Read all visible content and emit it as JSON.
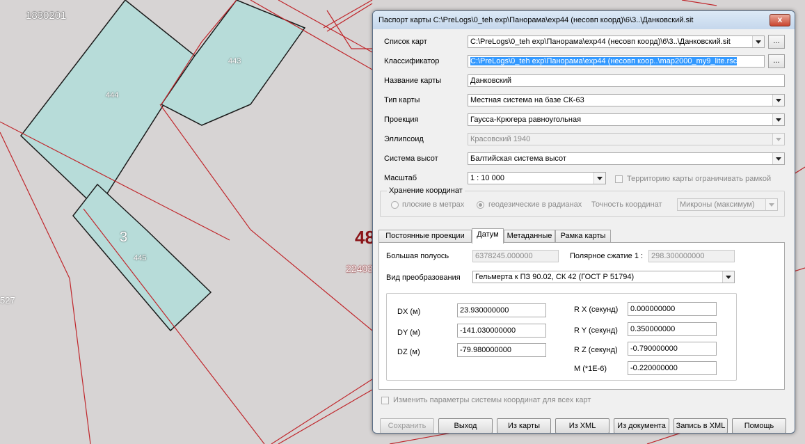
{
  "map": {
    "labels": {
      "code_1830201": "1830201",
      "parcel_444": "444",
      "parcel_443": "443",
      "parcel_445": "445",
      "parcel_3": "3",
      "code_48": "48",
      "code_22403": "22403",
      "code_527": "527"
    },
    "colors": {
      "parcel_fill": "#b7dcd9",
      "boundary": "#c0262b",
      "background": "#d7d4d4"
    }
  },
  "dialog": {
    "title": "Паспорт карты  C:\\PreLogs\\0_teh exp\\Панорама\\exp44 (несовп коорд)\\6\\3..\\Данковский.sit",
    "close_label": "x",
    "map_list": {
      "label": "Список карт",
      "value": "C:\\PreLogs\\0_teh exp\\Панорама\\exp44 (несовп коорд)\\6\\3..\\Данковский.sit",
      "dots": "..."
    },
    "classifier": {
      "label": "Классификатор",
      "value": "C:\\PreLogs\\0_teh exp\\Панорама\\exp44 (несовп коор..\\map2000_my9_lite.rsc",
      "dots": "..."
    },
    "map_name": {
      "label": "Название карты",
      "value": "Данковский"
    },
    "map_type": {
      "label": "Тип карты",
      "value": "Местная система на базе СК-63"
    },
    "projection": {
      "label": "Проекция",
      "value": "Гаусса-Крюгера равноугольная"
    },
    "ellipsoid": {
      "label": "Эллипсоид",
      "value": "Красовский 1940"
    },
    "height_system": {
      "label": "Система высот",
      "value": "Балтийская система высот"
    },
    "scale": {
      "label": "Масштаб",
      "value": "1 : 10 000",
      "limit_checkbox": "Территорию карты ограничивать рамкой"
    },
    "coord_storage": {
      "title": "Хранение координат",
      "flat": "плоские в метрах",
      "geodetic": "геодезические в радианах",
      "accuracy_label": "Точность координат",
      "accuracy_value": "Микроны (максимум)"
    },
    "tabs": [
      "Постоянные проекции",
      "Датум",
      "Метаданные",
      "Рамка карты"
    ],
    "datum": {
      "major_axis_label": "Большая полуось",
      "major_axis_value": "6378245.000000",
      "flattening_label": "Полярное сжатие  1 :",
      "flattening_value": "298.300000000",
      "transform_label": "Вид преобразования",
      "transform_value": "Гельмерта к ПЗ 90.02, СК 42 (ГОСТ Р 51794)",
      "params": {
        "dx_label": "DX (м)",
        "dx": "23.930000000",
        "dy_label": "DY (м)",
        "dy": "-141.030000000",
        "dz_label": "DZ (м)",
        "dz": "-79.980000000",
        "rx_label": "R X (секунд)",
        "rx": "0.000000000",
        "ry_label": "R Y (секунд)",
        "ry": "0.350000000",
        "rz_label": "R Z (секунд)",
        "rz": "-0.790000000",
        "m_label": "M (*1E-6)",
        "m": "-0.220000000"
      }
    },
    "change_all_checkbox": "Изменить параметры системы координат для всех карт",
    "buttons": {
      "save": "Сохранить",
      "exit": "Выход",
      "from_maps": "Из карты",
      "from_xml": "Из XML",
      "from_doc": "Из документа",
      "to_xml": "Запись в XML",
      "help": "Помощь"
    }
  }
}
